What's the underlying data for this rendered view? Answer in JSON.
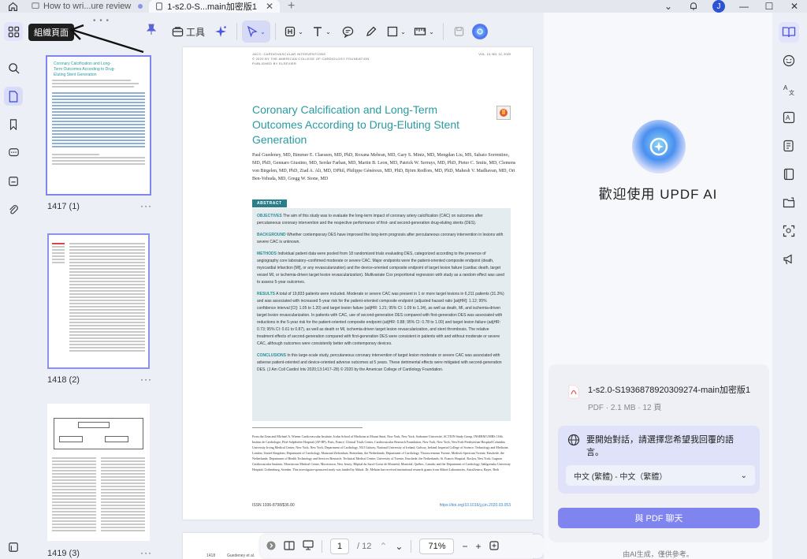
{
  "titlebar": {
    "tabs": [
      {
        "label": "How to wri...ure review"
      },
      {
        "label": "1-s2.0-S...main加密版1"
      }
    ],
    "avatar_letter": "J"
  },
  "tooltip": {
    "text": "組織頁面"
  },
  "thumbnails": [
    {
      "label": "1417 (1)",
      "more": "···"
    },
    {
      "label": "1418 (2)",
      "more": "···"
    },
    {
      "label": "1419 (3)",
      "more": "···"
    }
  ],
  "toolbar": {
    "tools_label": "工具"
  },
  "document": {
    "journal_line1": "JACC: CARDIOVASCULAR INTERVENTIONS",
    "journal_line2": "© 2020 BY THE AMERICAN COLLEGE OF CARDIOLOGY FOUNDATION",
    "journal_line3": "PUBLISHED BY ELSEVIER",
    "volume": "VOL. 13, NO. 12, 2020",
    "title": "Coronary Calcification and Long-Term Outcomes According to Drug-Eluting Stent Generation",
    "authors": "Paul Guedeney, MD, Bimmer E. Claessen, MD, PhD, Roxana Mehran, MD, Gary S. Mintz, MD, Mengdan Liu, MS, Sabato Sorrentino, MD, PhD, Gennaro Giustino, MD, Serdar Farhan, MD, Martin B. Leon, MD, Patrick W. Serruys, MD, PhD, Pieter C. Smits, MD, Clemens von Birgelen, MD, PhD, Ziad A. Ali, MD, DPhil, Philippe Généreux, MD, PhD, Björn Redfors, MD, PhD, Mahesh V. Madhavan, MD, Ori Ben-Yehuda, MD, Gregg W. Stone, MD",
    "abstract_tag": "ABSTRACT",
    "objectives_label": "OBJECTIVES",
    "objectives": "The aim of this study was to evaluate the long-term impact of coronary artery calcification (CAC) on outcomes after percutaneous coronary intervention and the respective performance of first- and second-generation drug-eluting stents (DES).",
    "background_label": "BACKGROUND",
    "background": "Whether contemporary DES have improved the long-term prognosis after percutaneous coronary intervention in lesions with severe CAC is unknown.",
    "methods_label": "METHODS",
    "methods": "Individual patient data were pooled from 18 randomized trials evaluating DES, categorized according to the presence of angiography core laboratory–confirmed moderate or severe CAC. Major endpoints were the patient-oriented composite endpoint (death, myocardial infarction [MI], or any revascularization) and the device-oriented composite endpoint of target lesion failure (cardiac death, target vessel MI, or ischemia-driven target lesion revascularization). Multivariate Cox proportional regression with study as a random effect was used to assess 5-year outcomes.",
    "results_label": "RESULTS",
    "results": "A total of 19,833 patients were included. Moderate or severe CAC was present in 1 or more target lesions in 6,211 patients (31.3%) and was associated with increased 5-year risk for the patient-oriented composite endpoint (adjusted hazard ratio [adjHR]: 1.12; 95% confidence interval [CI]: 1.05 to 1.20) and target lesion failure (adjHR: 1.21; 95% CI: 1.09 to 1.34), as well as death, MI, and ischemia-driven target lesion revascularization. In patients with CAC, use of second-generation DES compared with first-generation DES was associated with reductions in the 5-year risk for the patient-oriented composite endpoint (adjHR: 0.88; 95% CI: 0.78 to 1.00) and target lesion failure (adjHR: 0.73; 95% CI: 0.61 to 0.87), as well as death or MI, ischemia-driven target lesion revascularization, and stent thrombosis. The relative treatment effects of second-generation compared with first-generation DES were consistent in patients with and without moderate or severe CAC, although outcomes were consistently better with contemporary devices.",
    "conclusions_label": "CONCLUSIONS",
    "conclusions": "In this large-scale study, percutaneous coronary intervention of target lesion moderate or severe CAC was associated with adverse patient-oriented and device-oriented adverse outcomes at 5 years. These detrimental effects were mitigated with second-generation DES. (J Am Coll Cardiol Intv 2020;13:1417–28) © 2020 by the American College of Cardiology Foundation.",
    "footnote": "From the Zena and Michael A. Wiener Cardiovascular Institute, Icahn School of Medicine at Mount Sinai, New York, New York; Sorbonne Université, ACTION Study Group, INSERM UMRS 1166, Institut de Cardiologie, Pitié-Salpêtrière Hospital (AP-HP), Paris, France; Clinical Trials Center, Cardiovascular Research Foundation, New York, New York; NewYork-Presbyterian Hospital/Columbia University Irving Medical Center, New York, New York; Department of Cardiology, NUI Galway, National University of Ireland, Galway, Ireland; Imperial College of Science, Technology and Medicine, London, United Kingdom; Department of Cardiology, Maasstad Ziekenhuis, Rotterdam, the Netherlands; Department of Cardiology, Thoraxcentrum Twente, Medisch Spectrum Twente, Enschede, the Netherlands; Department of Health Technology and Services Research, Technical Medical Centre, University of Twente, Enschede, the Netherlands; St. Francis Hospital, Roslyn, New York; Gagnon Cardiovascular Institute, Morristown Medical Center, Morristown, New Jersey; Hôpital du Sacré-Coeur de Montréal, Montréal, Québec, Canada; and the Department of Cardiology, Sahlgrenska University Hospital, Gothenburg, Sweden. This investigator-sponsored study was funded by Abbott. Dr. Mehran has received institutional research grants from Abbott Laboratories, AstraZeneca, Bayer, Beth",
    "issn": "ISSN 1936-8798/$36.00",
    "doi": "https://doi.org/10.1016/j.jcin.2020.03.053",
    "next_page_num": "1418",
    "next_page_author": "Guedeney et al."
  },
  "bottom_nav": {
    "current_page": "1",
    "total_pages": "/ 12",
    "zoom": "71%"
  },
  "ai": {
    "title": "歡迎使用 UPDF AI",
    "file_name": "1-s2.0-S1936878920309274-main加密版1",
    "file_meta": "PDF · 2.1 MB · 12 頁",
    "language_prompt": "要開始對話，請選擇您希望我回覆的語言。",
    "language_value": "中文 (繁體) - 中文（繁體）",
    "chat_button": "與 PDF 聊天",
    "note": "由AI生成，僅供參考。"
  }
}
